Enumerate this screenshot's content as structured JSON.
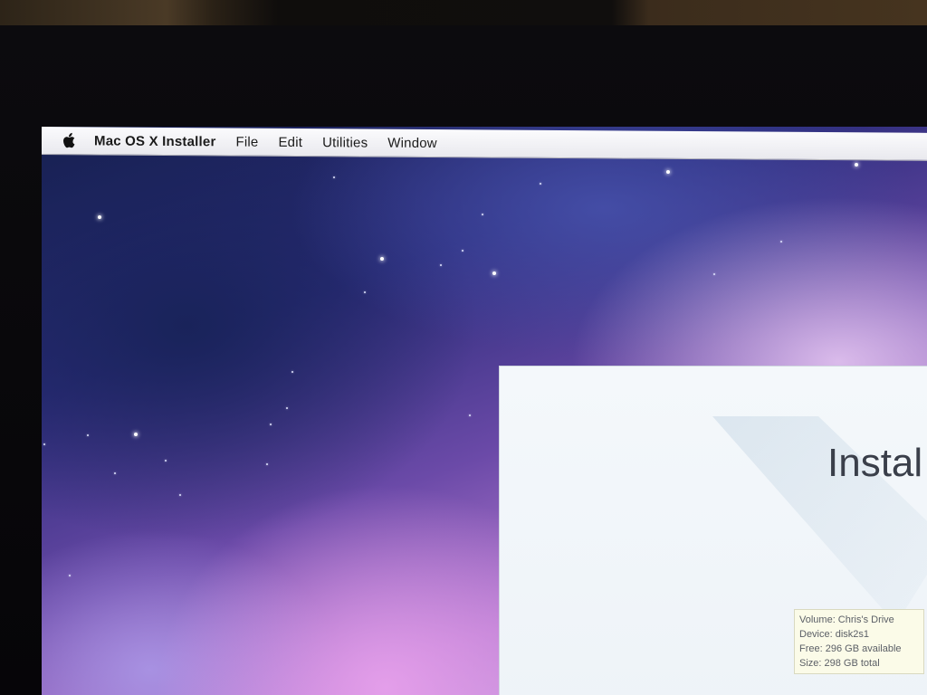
{
  "menubar": {
    "apple_icon": "apple-icon",
    "app_name": "Mac OS X Installer",
    "items": [
      "File",
      "Edit",
      "Utilities",
      "Window"
    ]
  },
  "installer_window": {
    "title": "Instal",
    "volume_info": {
      "volume": "Volume: Chris's Drive",
      "device": "Device: disk2s1",
      "free": "Free: 296 GB available",
      "size": "Size: 298 GB total"
    }
  },
  "colors": {
    "menubar_background": "#f0f0f4",
    "window_background": "#f2f6fa",
    "title_text": "#3a3f4a",
    "desktop_accent": "#6b4aa8"
  }
}
